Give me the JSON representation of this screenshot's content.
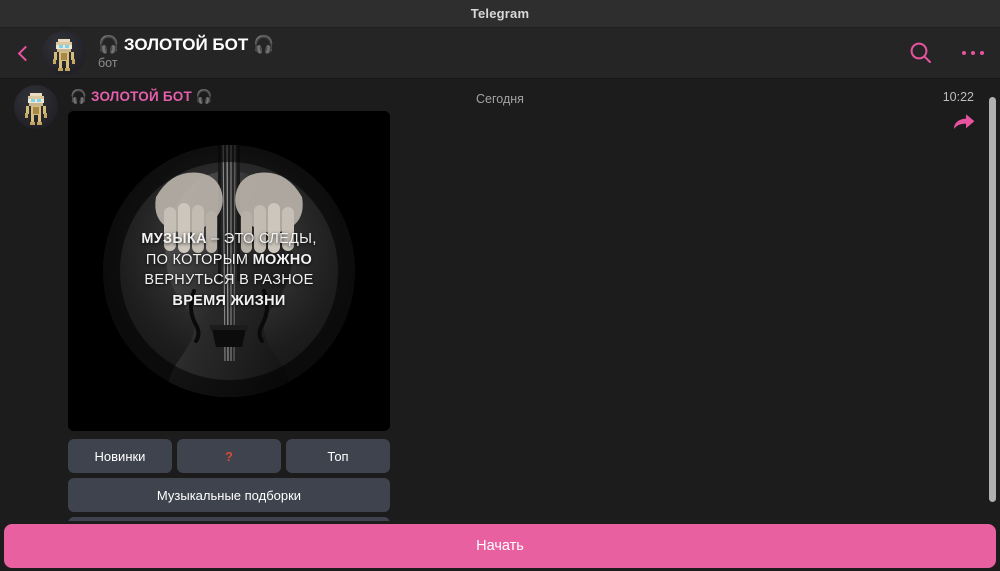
{
  "window": {
    "app_title": "Telegram"
  },
  "header": {
    "back_icon": "back-chevron-icon",
    "title": "🎧 ЗОЛОТОЙ БОТ 🎧",
    "subtitle": "бот",
    "search_icon": "search-icon",
    "menu_icon": "more-options-icon"
  },
  "chat": {
    "date_separator": "Сегодня",
    "message": {
      "sender": "🎧 ЗОЛОТОЙ БОТ 🎧",
      "time": "10:22",
      "forward_icon": "forward-arrow-icon",
      "photo": {
        "alt": "cello-quote-photo",
        "quote_lines": [
          {
            "bold_prefix": "МУЗЫКА",
            "rest": " – ЭТО СЛЕДЫ,"
          },
          {
            "plain_prefix": "ПО КОТОРЫМ ",
            "bold_suffix": "МОЖНО"
          },
          {
            "plain": "ВЕРНУТЬСЯ В РАЗНОЕ"
          },
          {
            "bold": "ВРЕМЯ ЖИЗНИ"
          }
        ]
      },
      "keyboard": {
        "row1": [
          {
            "label": "Новинки",
            "style": "normal"
          },
          {
            "label": "?",
            "style": "red"
          },
          {
            "label": "Топ",
            "style": "normal"
          }
        ],
        "row2": [
          {
            "label": "Музыкальные подборки",
            "style": "normal"
          }
        ],
        "row3": [
          {
            "label": "",
            "style": "normal"
          }
        ]
      }
    }
  },
  "bottom": {
    "start_label": "Начать"
  },
  "colors": {
    "accent_pink": "#e8539f",
    "start_button": "#e8609f",
    "sender_name": "#e45fab",
    "keyboard_button": "#3e434d",
    "question_red": "#d94a3d",
    "titlebar_bg": "#2e2e2e",
    "header_bg": "#252525",
    "chat_bg": "#1c1c1c"
  }
}
